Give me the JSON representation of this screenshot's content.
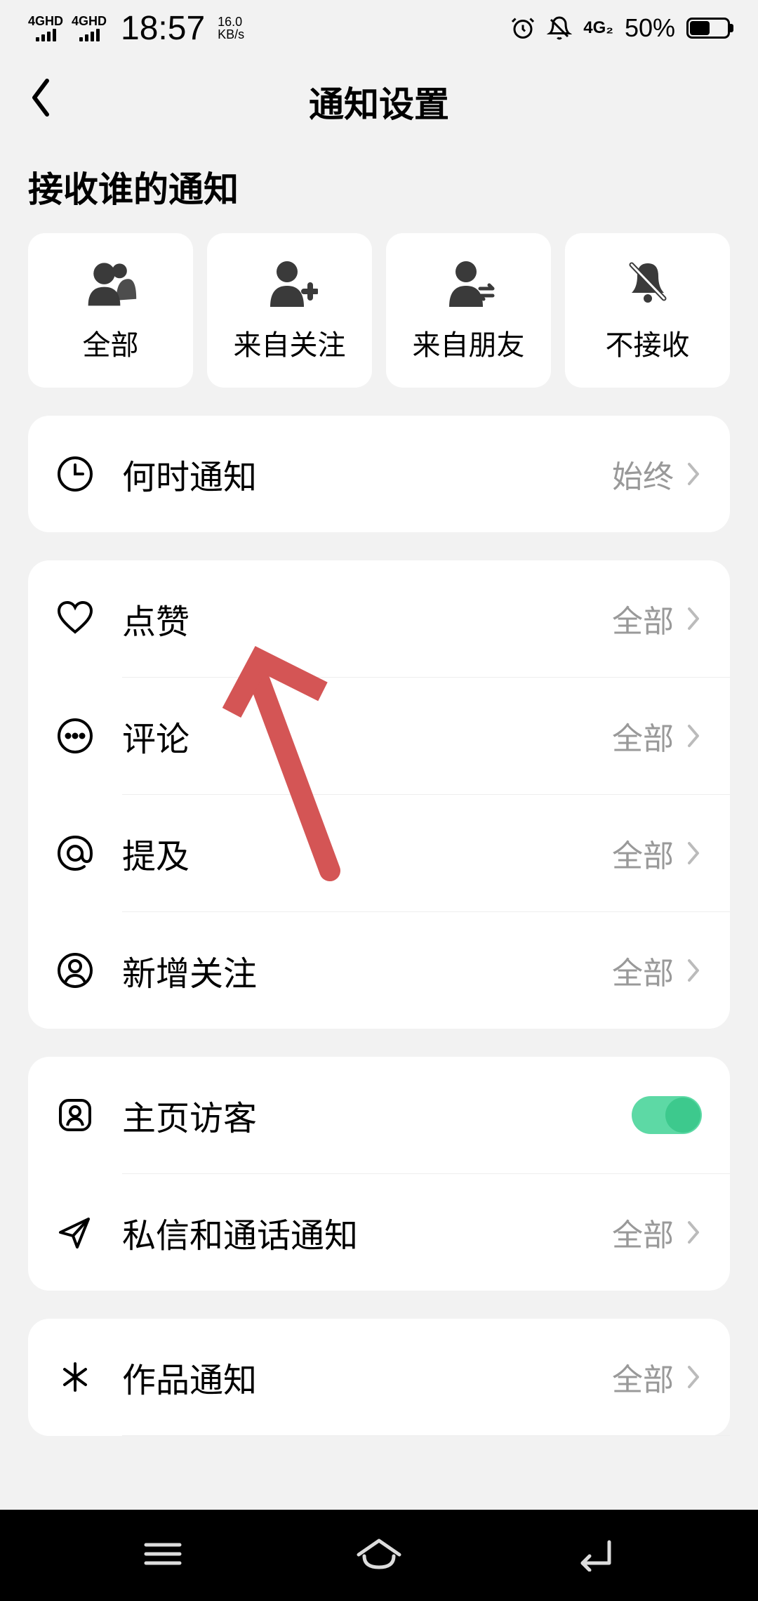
{
  "status_bar": {
    "signal1": "4GHD",
    "signal2": "4GHD",
    "time": "18:57",
    "speed_value": "16.0",
    "speed_unit": "KB/s",
    "network": "4G₂",
    "battery_pct": "50%"
  },
  "header": {
    "title": "通知设置"
  },
  "section_title": "接收谁的通知",
  "filters": [
    {
      "label": "全部",
      "icon": "people"
    },
    {
      "label": "来自关注",
      "icon": "person-add"
    },
    {
      "label": "来自朋友",
      "icon": "person-exchange"
    },
    {
      "label": "不接收",
      "icon": "bell-off"
    }
  ],
  "group1": {
    "when_notify": {
      "label": "何时通知",
      "value": "始终"
    }
  },
  "group2": {
    "likes": {
      "label": "点赞",
      "value": "全部"
    },
    "comments": {
      "label": "评论",
      "value": "全部"
    },
    "mentions": {
      "label": "提及",
      "value": "全部"
    },
    "new_follow": {
      "label": "新增关注",
      "value": "全部"
    }
  },
  "group3": {
    "visitors": {
      "label": "主页访客",
      "toggle": true
    },
    "messages": {
      "label": "私信和通话通知",
      "value": "全部"
    }
  },
  "group4": {
    "works": {
      "label": "作品通知",
      "value": "全部"
    }
  }
}
